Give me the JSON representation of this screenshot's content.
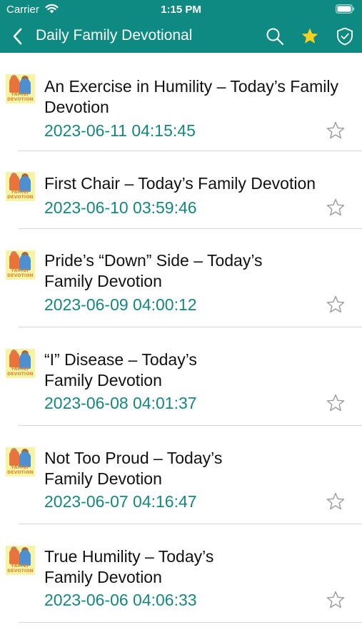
{
  "status_bar": {
    "carrier": "Carrier",
    "time": "1:15 PM"
  },
  "nav": {
    "title": "Daily Family Devotional",
    "icons": [
      "back-chevron-icon",
      "search-icon",
      "star-filled-icon",
      "shield-check-icon"
    ]
  },
  "thumbnail_caption": "FAMILY DEVOTION",
  "colors": {
    "header": "#0f8a82",
    "date": "#14877f",
    "favorite_star": "#f5d21f"
  },
  "items": [
    {
      "title": "An Exercise in Humility – Today’s Family Devotion",
      "date": "2023-06-11 04:15:45"
    },
    {
      "title": "First Chair – Today’s Family Devotion",
      "date": "2023-06-10 03:59:46"
    },
    {
      "title": "Pride’s “Down” Side – Today’s Family Devotion",
      "date": "2023-06-09 04:00:12"
    },
    {
      "title": "“I” Disease – Today’s Family Devotion",
      "date": "2023-06-08 04:01:37"
    },
    {
      "title": "Not Too Proud – Today’s Family Devotion",
      "date": "2023-06-07 04:16:47"
    },
    {
      "title": "True Humility – Today’s Family Devotion",
      "date": "2023-06-06 04:06:33"
    }
  ]
}
